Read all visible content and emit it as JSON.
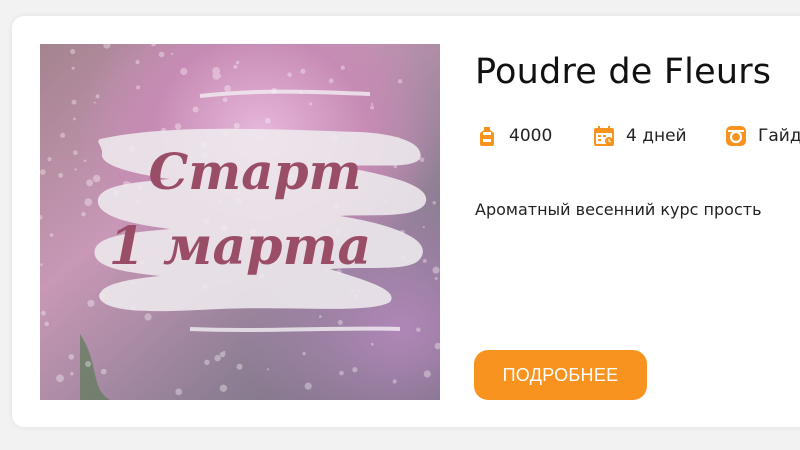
{
  "course": {
    "image_text": {
      "line1": "Старт",
      "line2": "1 марта"
    },
    "title": "Poudre de Fleurs",
    "meta": [
      {
        "icon": "price-tag-icon",
        "text": "4000"
      },
      {
        "icon": "calendar-icon",
        "text": "4 дней"
      },
      {
        "icon": "instagram-icon",
        "text": "Гайд"
      }
    ],
    "description": "Ароматный весенний курс прость",
    "button_label": "ПОДРОБНЕЕ"
  },
  "colors": {
    "accent": "#f7931e",
    "script_text": "#9a4d66"
  }
}
